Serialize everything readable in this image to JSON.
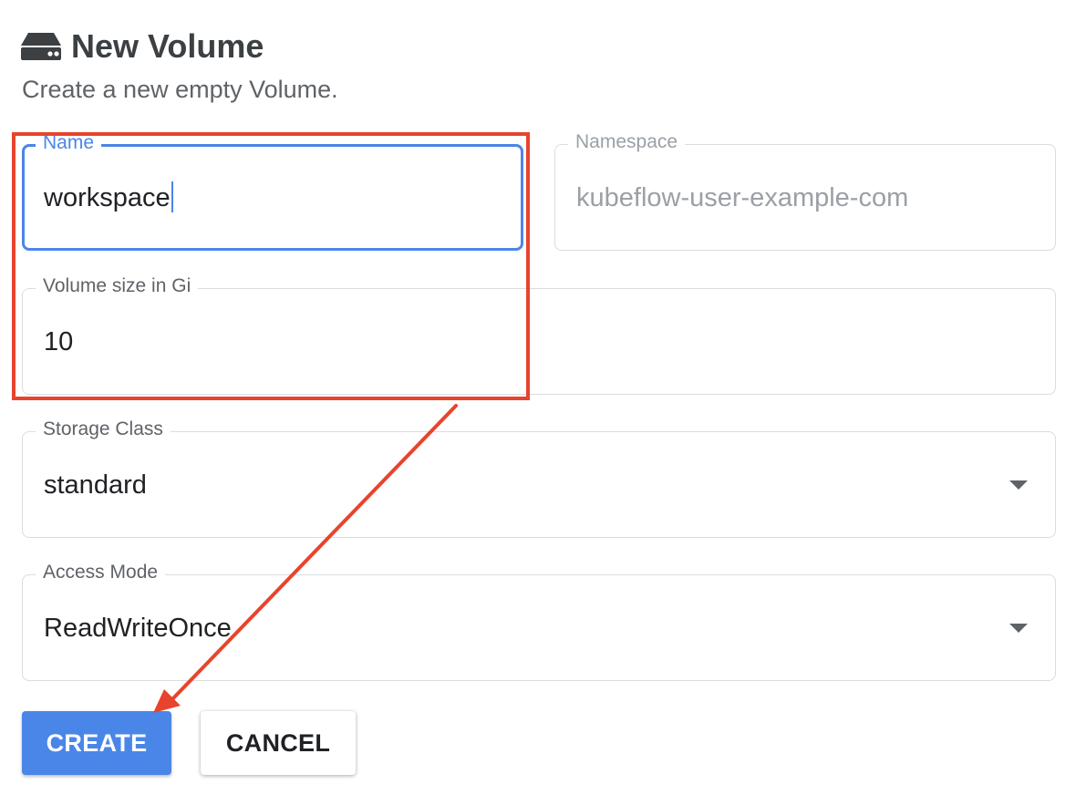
{
  "header": {
    "icon": "drive-icon",
    "title": "New Volume",
    "subtitle": "Create a new empty Volume."
  },
  "form": {
    "name": {
      "label": "Name",
      "value": "workspace"
    },
    "namespace": {
      "label": "Namespace",
      "value": "kubeflow-user-example-com"
    },
    "size": {
      "label": "Volume size in Gi",
      "value": "10"
    },
    "storage_class": {
      "label": "Storage Class",
      "value": "standard"
    },
    "access_mode": {
      "label": "Access Mode",
      "value": "ReadWriteOnce"
    }
  },
  "actions": {
    "create_label": "CREATE",
    "cancel_label": "CANCEL"
  },
  "colors": {
    "primary": "#4a86e8",
    "annotation": "#e8442d",
    "title_text": "#3c4043"
  }
}
